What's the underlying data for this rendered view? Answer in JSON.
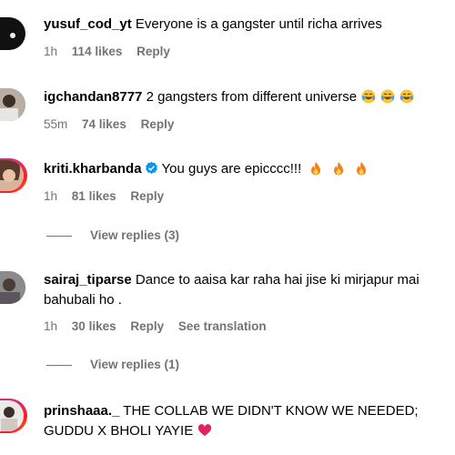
{
  "comments": [
    {
      "username": "yusuf_cod_yt",
      "text": "Everyone is a gangster until richa arrives",
      "time": "1h",
      "likes": "114 likes",
      "reply": "Reply"
    },
    {
      "username": "igchandan8777",
      "text": "2 gangsters from different universe",
      "emoji": [
        "laughing-tears",
        "laughing-tears",
        "laughing-tears"
      ],
      "time": "55m",
      "likes": "74 likes",
      "reply": "Reply"
    },
    {
      "username": "kriti.kharbanda",
      "verified": true,
      "text": "You guys are epicccc!!!",
      "emoji": [
        "fire",
        "fire",
        "fire"
      ],
      "time": "1h",
      "likes": "81 likes",
      "reply": "Reply",
      "view_replies": "View replies (3)"
    },
    {
      "username": "sairaj_tiparse",
      "text": "Dance to aaisa kar raha hai jise ki mirjapur mai",
      "text_line2": "bahubali ho .",
      "time": "1h",
      "likes": "30 likes",
      "reply": "Reply",
      "see_translation": "See translation",
      "view_replies": "View replies (1)"
    },
    {
      "username": "prinshaaa._",
      "text": "THE COLLAB WE DIDN'T KNOW WE NEEDED;",
      "text_line2": "GUDDU X BHOLI YAYIE",
      "emoji": [
        "red-heart"
      ]
    }
  ],
  "colors": {
    "meta_gray": "#737373",
    "verified_blue": "#0095f6"
  }
}
